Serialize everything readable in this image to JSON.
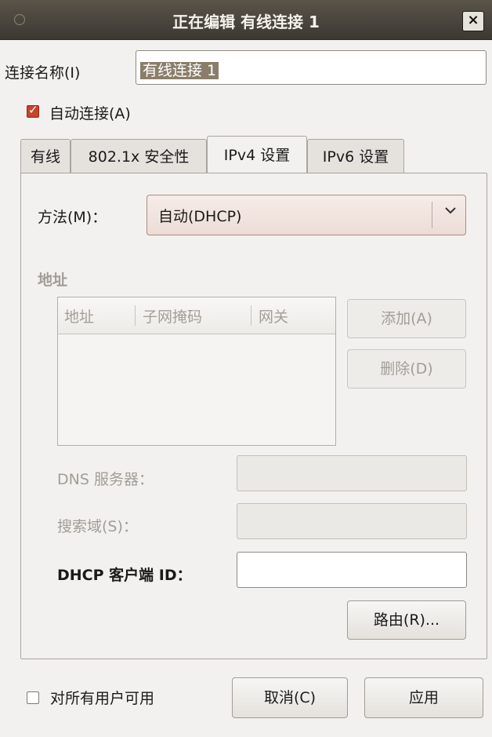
{
  "window": {
    "title": "正在编辑 有线连接 1",
    "close_symbol": "×"
  },
  "connection_name": {
    "label": "连接名称(I)",
    "mnemonic": "I",
    "value": "有线连接 1"
  },
  "auto_connect": {
    "label": "自动连接(A)",
    "checked": true
  },
  "tabs": [
    {
      "label": "有线",
      "active": false
    },
    {
      "label": "802.1x 安全性",
      "active": false
    },
    {
      "label": "IPv4 设置",
      "active": true
    },
    {
      "label": "IPv6 设置",
      "active": false
    }
  ],
  "method": {
    "label": "方法(M)：",
    "value": "自动(DHCP)"
  },
  "address_section": {
    "heading": "地址",
    "columns": [
      "地址",
      "子网掩码",
      "网关"
    ],
    "add_label": "添加(A)",
    "delete_label": "删除(D)"
  },
  "dns": {
    "label": "DNS 服务器：",
    "value": ""
  },
  "search_domain": {
    "label": "搜索域(S)：",
    "value": ""
  },
  "dhcp_client_id": {
    "label": "DHCP 客户端 ID：",
    "value": ""
  },
  "routes_label": "路由(R)...",
  "available_all_users": {
    "label": "对所有用户可用",
    "checked": false
  },
  "cancel_label": "取消(C)",
  "apply_label": "应用",
  "colors": {
    "titlebar": "#3c3832",
    "accent": "#c4442c",
    "background": "#f2f1f0"
  }
}
